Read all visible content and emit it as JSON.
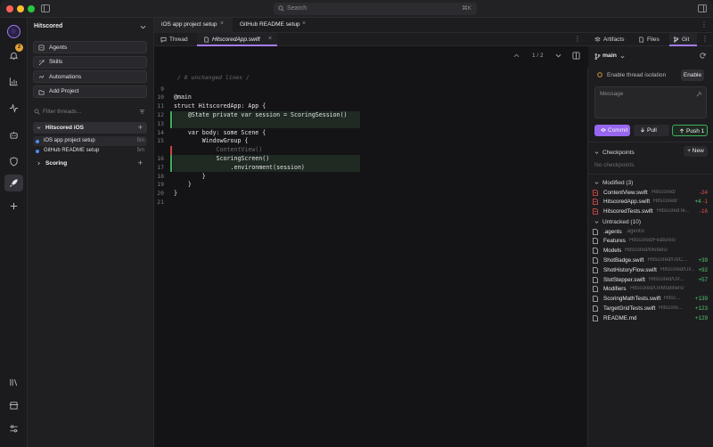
{
  "search": {
    "placeholder": "Search",
    "shortcut": "⌘K"
  },
  "rail": {
    "notification_count": "2",
    "items": [
      "bell-icon",
      "chart-icon",
      "activity-icon",
      "bot-icon",
      "shield-icon",
      "rocket-icon",
      "plus-icon",
      "library-icon",
      "store-icon",
      "sliders-icon"
    ]
  },
  "sidebar": {
    "workspace": "Hitscored",
    "buttons": [
      {
        "label": "Agents",
        "icon": "agents-icon"
      },
      {
        "label": "Skills",
        "icon": "skills-icon"
      },
      {
        "label": "Automations",
        "icon": "automations-icon"
      },
      {
        "label": "Add Project",
        "icon": "add-project-icon"
      }
    ],
    "filter_placeholder": "Filter threads...",
    "projects": [
      {
        "name": "Hitscored iOS",
        "threads": [
          {
            "name": "iOS app project setup",
            "time": "5m"
          },
          {
            "name": "GitHub README setup",
            "time": "5m"
          }
        ]
      },
      {
        "name": "Scoring"
      }
    ]
  },
  "tabs": [
    {
      "label": "iOS app project setup"
    },
    {
      "label": "GitHub README setup"
    }
  ],
  "editor": {
    "subtabs": [
      {
        "label": "Thread"
      },
      {
        "label": "HitscoredApp.swift"
      }
    ],
    "diff_position": "1 / 2",
    "unchanged_note": "8 unchanged lines",
    "lines": [
      {
        "n": "9",
        "text": "",
        "kind": "normal"
      },
      {
        "n": "10",
        "text": "@main",
        "kind": "normal"
      },
      {
        "n": "11",
        "text": "struct HitscoredApp: App {",
        "kind": "normal"
      },
      {
        "n": "12",
        "text": "    @State private var session = ScoringSession()",
        "kind": "add"
      },
      {
        "n": "13",
        "text": "",
        "kind": "add"
      },
      {
        "n": "14",
        "text": "    var body: some Scene {",
        "kind": "normal"
      },
      {
        "n": "15",
        "text": "        WindowGroup {",
        "kind": "normal"
      },
      {
        "n": "",
        "text": "            ContentView()",
        "kind": "del"
      },
      {
        "n": "16",
        "text": "            ScoringScreen()",
        "kind": "add"
      },
      {
        "n": "17",
        "text": "                .environment(session)",
        "kind": "add"
      },
      {
        "n": "18",
        "text": "        }",
        "kind": "normal"
      },
      {
        "n": "19",
        "text": "    }",
        "kind": "normal"
      },
      {
        "n": "20",
        "text": "}",
        "kind": "normal"
      },
      {
        "n": "21",
        "text": "",
        "kind": "normal"
      }
    ]
  },
  "right": {
    "tabs": [
      {
        "label": "Artifacts"
      },
      {
        "label": "Files"
      },
      {
        "label": "Git"
      }
    ],
    "branch": "main",
    "isolation_label": "Enable thread isolation",
    "enable_label": "Enable",
    "message_placeholder": "Message",
    "commit_label": "Commit",
    "pull_label": "Pull",
    "push_label": "Push 1",
    "checkpoints_label": "Checkpoints",
    "new_label": "New",
    "no_checkpoints": "No checkpoints",
    "modified_label": "Modified (3)",
    "modified": [
      {
        "name": "ContentView.swift",
        "path": "Hitscored/",
        "del": "-24"
      },
      {
        "name": "HitscoredApp.swift",
        "path": "Hitscored/",
        "add": "+4",
        "del": "-1"
      },
      {
        "name": "HitscoredTests.swift",
        "path": "HitscoredTe...",
        "del": "-16"
      }
    ],
    "untracked_label": "Untracked (10)",
    "untracked": [
      {
        "name": ".agents",
        "path": ".agents/"
      },
      {
        "name": "Features",
        "path": "Hitscored/Features/"
      },
      {
        "name": "Models",
        "path": "Hitscored/Models/"
      },
      {
        "name": "ShotBadge.swift",
        "path": "Hitscored/UI/C...",
        "add": "+39"
      },
      {
        "name": "ShotHistoryFlow.swift",
        "path": "Hitscored/UI/...",
        "add": "+92"
      },
      {
        "name": "SlotStepper.swift",
        "path": "Hitscored/UI/...",
        "add": "+57"
      },
      {
        "name": "Modifiers",
        "path": "Hitscored/UI/Modifiers/"
      },
      {
        "name": "ScoringMathTests.swift",
        "path": "Hitsc...",
        "add": "+139"
      },
      {
        "name": "TargetGridTests.swift",
        "path": "Hitscore...",
        "add": "+123"
      },
      {
        "name": "README.md",
        "path": "",
        "add": "+129"
      }
    ]
  },
  "colors": {
    "accent": "#9867f0",
    "added": "#4fc66b",
    "removed": "#e5534b"
  }
}
